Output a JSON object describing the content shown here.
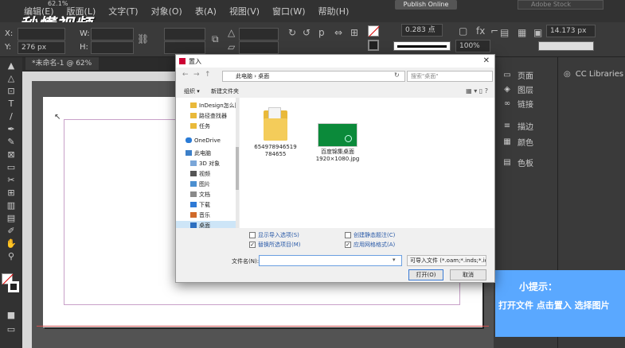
{
  "menubar": {
    "items": [
      "编辑(E)",
      "版面(L)",
      "文字(T)",
      "对象(O)",
      "表(A)",
      "视图(V)",
      "窗口(W)",
      "帮助(H)"
    ],
    "zoom": "62.1%",
    "publish": "Publish Online",
    "stock_placeholder": "Adobe Stock"
  },
  "watermark": "秒懂视频",
  "controlbar": {
    "x_label": "X:",
    "y_label": "Y:",
    "y_value": "276 px",
    "h_label": "H:",
    "stroke_weight": "0.283 点",
    "percent": "100%",
    "size": "14.173 px"
  },
  "doc_tab": {
    "title": "*未命名-1 @ 62%",
    "close": "×"
  },
  "panels": {
    "items": [
      {
        "icon": "▭",
        "label": "页面"
      },
      {
        "icon": "◈",
        "label": "图层"
      },
      {
        "icon": "∞",
        "label": "链接"
      },
      {
        "icon": "≡",
        "label": "描边"
      },
      {
        "icon": "▦",
        "label": "颜色"
      },
      {
        "icon": "▤",
        "label": "色板"
      }
    ],
    "cc_libraries": "CC Libraries"
  },
  "tip": {
    "title": "小提示：",
    "body": "打开文件  点击置入  选择图片"
  },
  "dialog": {
    "title": "置入",
    "close": "✕",
    "address": "此电脑 › 桌面",
    "search_placeholder": "搜索\"桌面\"",
    "organize": "组织 ▾",
    "new_folder": "新建文件夹",
    "nav_items": [
      {
        "label": "InDesign怎么降",
        "icon": "folder",
        "indent": 1
      },
      {
        "label": "路径查找器",
        "icon": "folder",
        "indent": 1
      },
      {
        "label": "任务",
        "icon": "folder",
        "indent": 1
      },
      {
        "label": "OneDrive",
        "icon": "cloud",
        "indent": 0
      },
      {
        "label": "此电脑",
        "icon": "pc",
        "indent": 0
      },
      {
        "label": "3D 对象",
        "icon": "obj3d",
        "indent": 1
      },
      {
        "label": "视频",
        "icon": "video",
        "indent": 1
      },
      {
        "label": "图片",
        "icon": "pic",
        "indent": 1
      },
      {
        "label": "文档",
        "icon": "doc",
        "indent": 1
      },
      {
        "label": "下载",
        "icon": "down",
        "indent": 1
      },
      {
        "label": "音乐",
        "icon": "music",
        "indent": 1
      },
      {
        "label": "桌面",
        "icon": "desk",
        "indent": 1
      }
    ],
    "files": [
      {
        "name_line1": "654978946519",
        "name_line2": "784655",
        "type": "folder"
      },
      {
        "name_line1": "百度锦集桌面",
        "name_line2": "1920×1080.jpg",
        "type": "image"
      }
    ],
    "options": {
      "show_import": "显示导入选项(S)",
      "replace_selected": "替换所选项目(M)",
      "create_static": "创建静态题注(C)",
      "apply_grid": "应用网格格式(A)"
    },
    "filename_label": "文件名(N):",
    "filetype": "可导入文件 (*.oam;*.inds;*.idr",
    "open": "打开(O)",
    "cancel": "取消"
  }
}
